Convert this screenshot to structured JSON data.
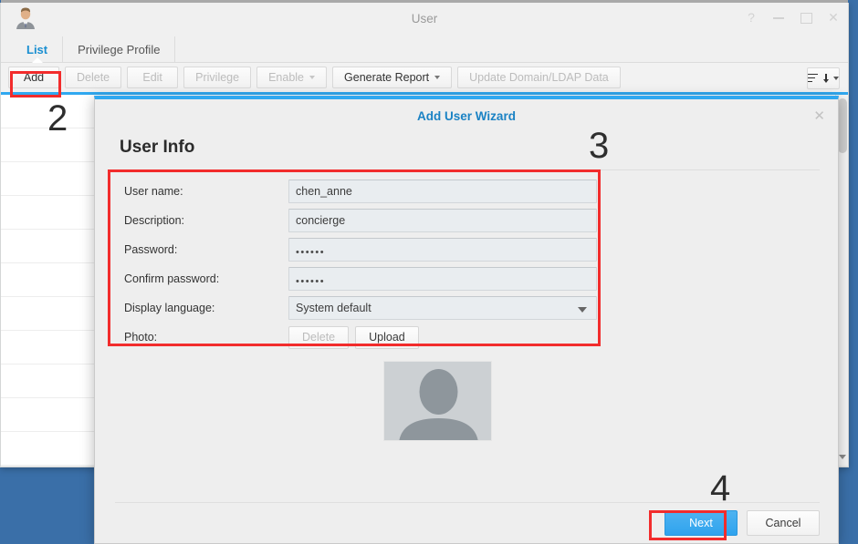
{
  "window": {
    "title": "User",
    "icon": "user-avatar-icon",
    "controls": [
      {
        "name": "help-button",
        "glyph": "?"
      },
      {
        "name": "minimize-button",
        "glyph": "–"
      },
      {
        "name": "maximize-button",
        "glyph": "□"
      },
      {
        "name": "close-button",
        "glyph": "✕"
      }
    ]
  },
  "tabs": [
    {
      "label": "List",
      "active": true
    },
    {
      "label": "Privilege Profile",
      "active": false
    }
  ],
  "toolbar": {
    "add_label": "Add",
    "delete_label": "Delete",
    "edit_label": "Edit",
    "privilege_label": "Privilege",
    "enable_label": "Enable",
    "generate_report_label": "Generate Report",
    "update_domain_label": "Update Domain/LDAP Data",
    "sort_icon": "sort-list-icon"
  },
  "modal": {
    "title": "Add User Wizard",
    "close_glyph": "✕",
    "heading": "User Info",
    "fields": [
      {
        "label": "User name:",
        "value": "chen_anne",
        "type": "text",
        "name": "user-name"
      },
      {
        "label": "Description:",
        "value": "concierge",
        "type": "text",
        "name": "description"
      },
      {
        "label": "Password:",
        "value": "••••••",
        "type": "password",
        "name": "password"
      },
      {
        "label": "Confirm password:",
        "value": "••••••",
        "type": "password",
        "name": "confirm-password"
      },
      {
        "label": "Display language:",
        "value": "System default",
        "type": "select",
        "name": "display-language"
      }
    ],
    "photo": {
      "label": "Photo:",
      "delete_label": "Delete",
      "upload_label": "Upload",
      "preview_icon": "person-placeholder-icon"
    },
    "next_label": "Next",
    "cancel_label": "Cancel"
  },
  "annotations": [
    {
      "number": "2",
      "target": "add-button"
    },
    {
      "number": "3",
      "target": "user-info-form"
    },
    {
      "number": "4",
      "target": "next-button"
    }
  ],
  "colors": {
    "accent_blue": "#30a8f0",
    "title_blue": "#1a82c4",
    "highlight_red": "#f22c2c",
    "desktop_blue": "#3a6fa8",
    "field_bg": "#e9edf0"
  }
}
